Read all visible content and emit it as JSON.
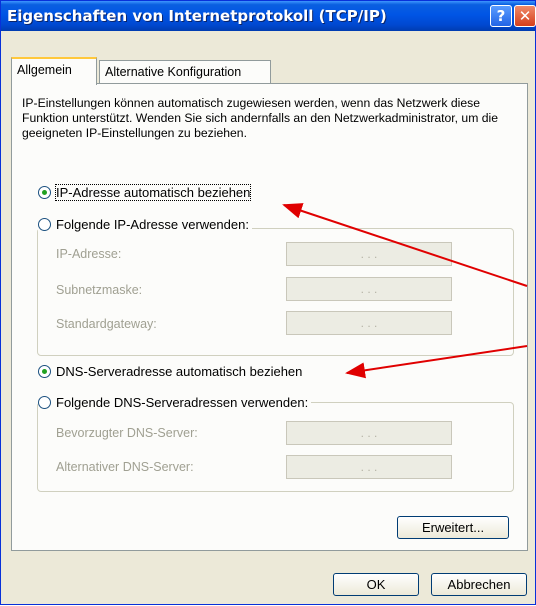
{
  "window": {
    "title": "Eigenschaften von Internetprotokoll (TCP/IP)",
    "help_label": "?",
    "close_label": "✕"
  },
  "tabs": [
    {
      "label": "Allgemein",
      "active": true
    },
    {
      "label": "Alternative Konfiguration",
      "active": false
    }
  ],
  "description": "IP-Einstellungen können automatisch zugewiesen werden, wenn das Netzwerk diese Funktion unterstützt. Wenden Sie sich andernfalls an den Netzwerkadministrator, um die geeigneten IP-Einstellungen zu beziehen.",
  "ip": {
    "auto_option": {
      "label": "IP-Adresse automatisch beziehen",
      "checked": true
    },
    "manual_option": {
      "label": "Folgende IP-Adresse verwenden:",
      "checked": false
    },
    "fields": [
      {
        "label": "IP-Adresse:",
        "value": ".   .   ."
      },
      {
        "label": "Subnetzmaske:",
        "value": ".   .   ."
      },
      {
        "label": "Standardgateway:",
        "value": ".   .   ."
      }
    ]
  },
  "dns": {
    "auto_option": {
      "label": "DNS-Serveradresse automatisch beziehen",
      "checked": true
    },
    "manual_option": {
      "label": "Folgende DNS-Serveradressen verwenden:",
      "checked": false
    },
    "fields": [
      {
        "label": "Bevorzugter DNS-Server:",
        "value": ".   .   ."
      },
      {
        "label": "Alternativer DNS-Server:",
        "value": ".   .   ."
      }
    ]
  },
  "buttons": {
    "advanced": "Erweitert...",
    "ok": "OK",
    "cancel": "Abbrechen"
  },
  "colors": {
    "titlebar": "#0055e5",
    "annotation_arrow": "#e00000",
    "radio_dot": "#21a121"
  }
}
